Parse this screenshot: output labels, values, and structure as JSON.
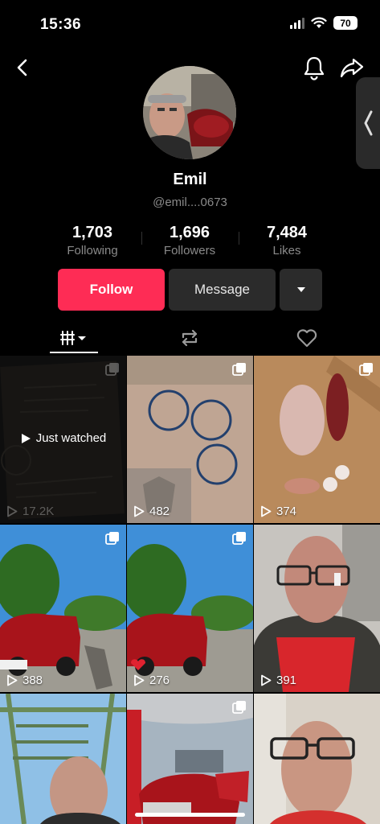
{
  "status": {
    "time": "15:36",
    "battery": "70"
  },
  "profile": {
    "name": "Emil",
    "handle": "@emil....0673",
    "stats": [
      {
        "value": "1,703",
        "label": "Following"
      },
      {
        "value": "1,696",
        "label": "Followers"
      },
      {
        "value": "7,484",
        "label": "Likes"
      }
    ]
  },
  "actions": {
    "follow_label": "Follow",
    "message_label": "Message"
  },
  "colors": {
    "accent": "#fe2c55",
    "background": "#000000",
    "secondary_button": "#2b2b2b"
  },
  "icons": [
    "back-icon",
    "bell-icon",
    "share-icon",
    "chevron-left-icon",
    "caret-down-icon",
    "grid-icon",
    "repost-icon",
    "heart-icon",
    "play-icon",
    "multi-photo-icon"
  ],
  "videos": [
    {
      "views": "17.2K",
      "overlay": "Just watched"
    },
    {
      "views": "482"
    },
    {
      "views": "374"
    },
    {
      "views": "388"
    },
    {
      "views": "276"
    },
    {
      "views": "391"
    },
    {
      "views": ""
    },
    {
      "views": ""
    },
    {
      "views": ""
    }
  ]
}
